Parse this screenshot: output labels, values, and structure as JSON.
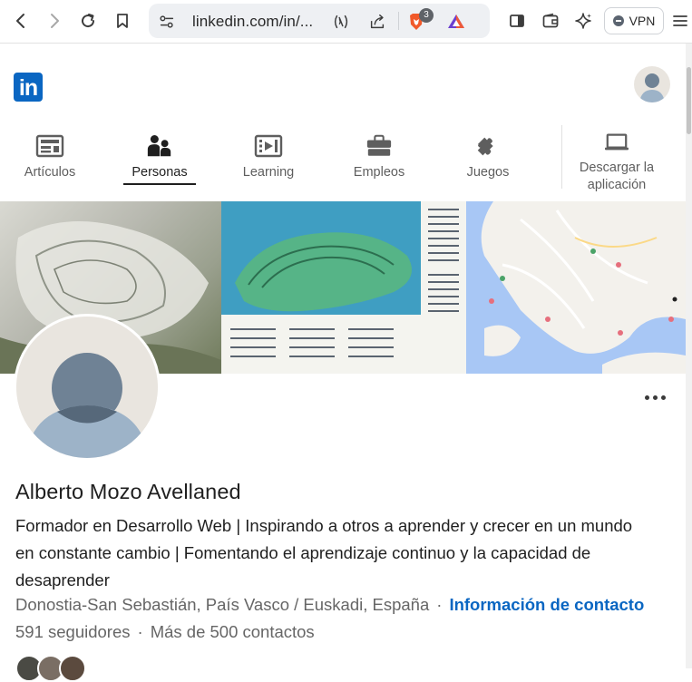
{
  "browser": {
    "url": "linkedin.com/in/...",
    "shields_count": "3",
    "vpn_label": "VPN",
    "icons": [
      "back-icon",
      "forward-icon",
      "reload-icon",
      "bookmark-icon",
      "site-settings-icon",
      "reader-mode-icon",
      "share-icon",
      "brave-shields-icon",
      "brave-rewards-icon",
      "sidebar-icon",
      "wallet-icon",
      "leo-ai-icon",
      "menu-icon"
    ]
  },
  "header": {
    "logo_text": "in",
    "brand_color": "#0a66c2"
  },
  "nav": {
    "items": [
      {
        "label": "Artículos",
        "icon": "articles-icon"
      },
      {
        "label": "Personas",
        "icon": "people-icon",
        "active": true
      },
      {
        "label": "Learning",
        "icon": "learning-icon"
      },
      {
        "label": "Empleos",
        "icon": "jobs-briefcase-icon"
      },
      {
        "label": "Juegos",
        "icon": "games-puzzle-icon"
      }
    ],
    "download_label": "Descargar la aplicación"
  },
  "profile": {
    "name": "Alberto Mozo Avellaned",
    "headline": "Formador en Desarrollo Web | Inspirando a otros a aprender y crecer en un mundo en constante cambio | Fomentando el aprendizaje continuo y la capacidad de desaprender",
    "location": "Donostia-San Sebastián, País Vasco / Euskadi, España",
    "separator": "·",
    "contact_info": "Información de contacto",
    "followers": "591 seguidores",
    "connections": "Más de 500 contactos"
  }
}
